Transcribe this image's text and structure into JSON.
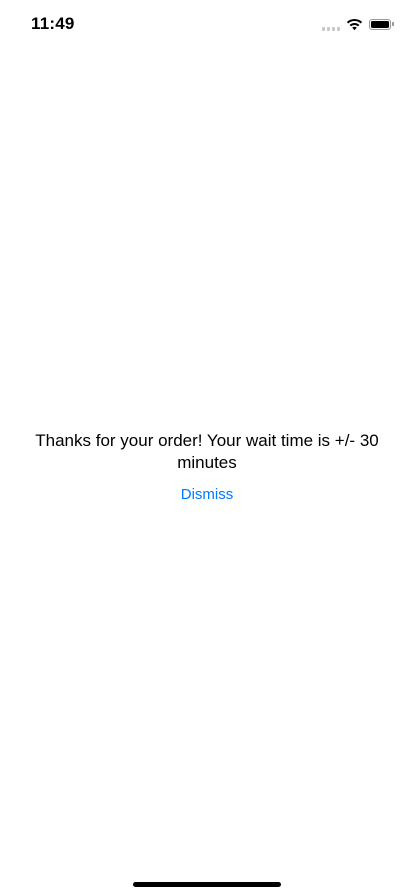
{
  "status_bar": {
    "time": "11:49",
    "cell_icon": "cellular-signal-icon",
    "wifi_icon": "wifi-icon",
    "battery_icon": "battery-icon",
    "battery_level": 1.0
  },
  "confirmation": {
    "message": "Thanks for your order! Your wait time is +/- 30 minutes",
    "dismiss_label": "Dismiss",
    "accent_color": "#007aff"
  },
  "home_indicator": {
    "icon": "home-indicator"
  }
}
